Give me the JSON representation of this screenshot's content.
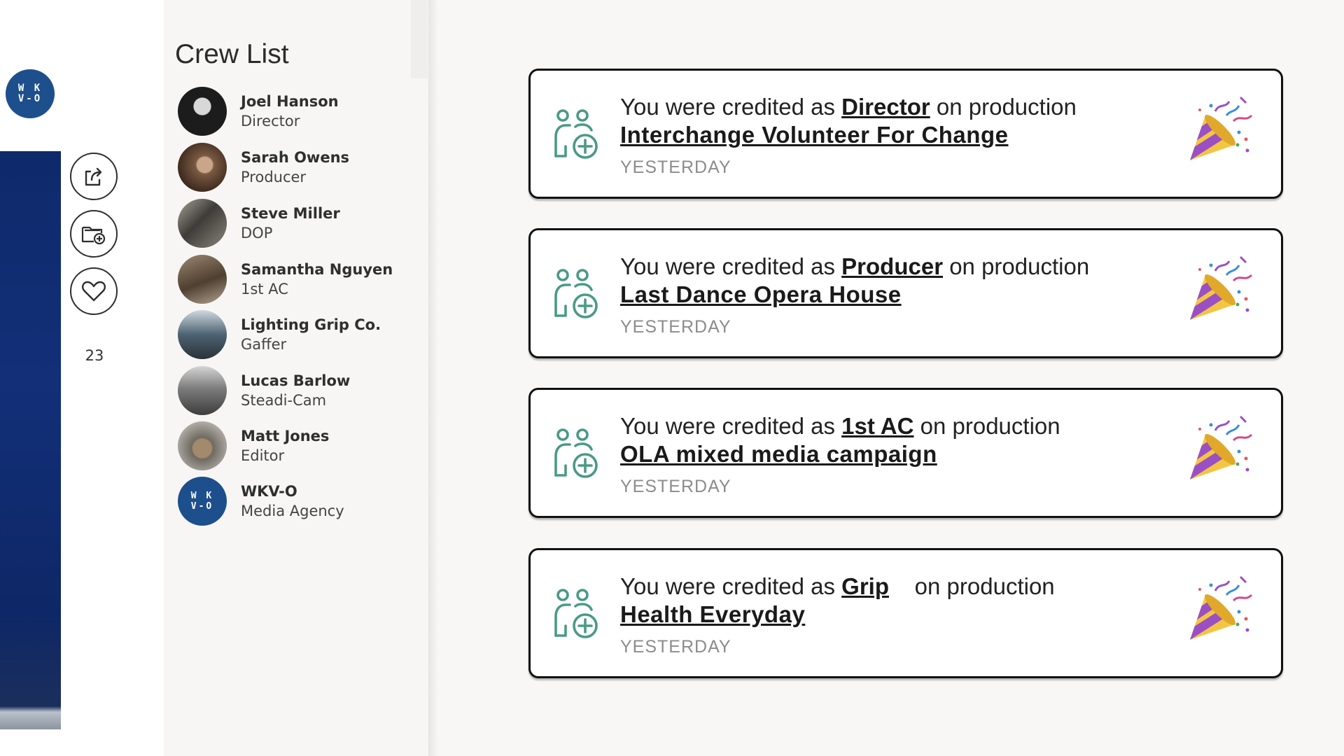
{
  "left_page": {
    "org_avatar_text": "W K\nV-O",
    "like_count": "23"
  },
  "crew": {
    "title": "Crew List",
    "members": [
      {
        "name": "Joel Hanson",
        "role": "Director",
        "avatar_color": "#1c1c1c"
      },
      {
        "name": "Sarah Owens",
        "role": "Producer",
        "avatar_color": "#7a5a42"
      },
      {
        "name": "Steve Miller",
        "role": "DOP",
        "avatar_color": "#5a5a55"
      },
      {
        "name": "Samantha Nguyen",
        "role": "1st AC",
        "avatar_color": "#6b5a48"
      },
      {
        "name": "Lighting Grip Co.",
        "role": "Gaffer",
        "avatar_color": "#4d6272"
      },
      {
        "name": "Lucas Barlow",
        "role": "Steadi-Cam",
        "avatar_color": "#7d7d7d"
      },
      {
        "name": "Matt Jones",
        "role": "Editor",
        "avatar_color": "#6f6a62"
      },
      {
        "name": "WKV-O",
        "role": "Media Agency",
        "avatar_color": "#1d4f8c",
        "avatar_text": "W K\nV-O"
      }
    ]
  },
  "notifications": [
    {
      "prefix": "You were credited as ",
      "role": "Director",
      "suffix": " on production",
      "production": "Interchange Volunteer For Change",
      "time": "YESTERDAY"
    },
    {
      "prefix": "You were credited as ",
      "role": "Producer",
      "suffix": " on production",
      "production": "Last Dance Opera House",
      "time": "YESTERDAY"
    },
    {
      "prefix": "You were credited as ",
      "role": "1st AC",
      "suffix": " on production",
      "production": "OLA mixed media campaign",
      "time": "YESTERDAY"
    },
    {
      "prefix": "You were credited as ",
      "role": "Grip",
      "suffix": "    on production",
      "production": "Health Everyday",
      "time": "YESTERDAY"
    }
  ],
  "colors": {
    "icon_teal": "#4a9a86",
    "card_border": "#111111",
    "avatar_blue": "#1d4f8c"
  },
  "icons": {
    "credit": "add-crew-icon",
    "celebration": "party-popper-icon",
    "share": "share-icon",
    "save": "add-folder-icon",
    "like": "heart-icon"
  }
}
